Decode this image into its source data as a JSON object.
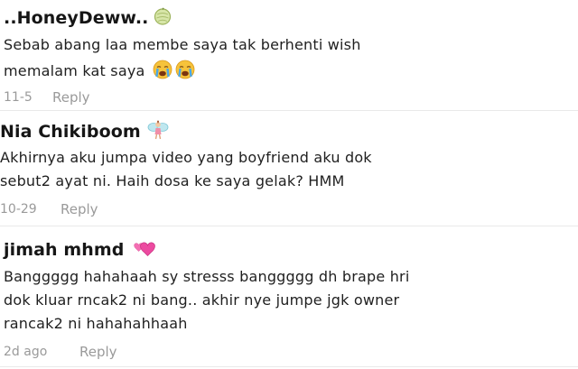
{
  "comments": [
    {
      "username": "..HoneyDeww..",
      "name_emoji": "melon-emoji",
      "lines": [
        "Sebab abang laa membe saya tak berhenti wish",
        "memalam kat saya"
      ],
      "trailing_emoji": "crying-face-emoji ×2",
      "date": "11-5",
      "reply": "Reply"
    },
    {
      "username": "Nia Chikiboom",
      "name_emoji": "fairy-emoji",
      "lines": [
        "Akhirnya aku jumpa video yang boyfriend aku dok",
        "sebut2 ayat ni. Haih dosa ke saya gelak? HMM"
      ],
      "date": "10-29",
      "reply": "Reply"
    },
    {
      "username": "jimah mhmd",
      "name_emoji": "two-hearts-emoji",
      "lines": [
        "Banggggg hahahaah sy stresss banggggg dh brape hri",
        "dok kluar rncak2 ni bang.. akhir nye jumpe jgk owner",
        "rancak2 ni hahahahhaah"
      ],
      "date": "2d ago",
      "reply": "Reply"
    }
  ]
}
